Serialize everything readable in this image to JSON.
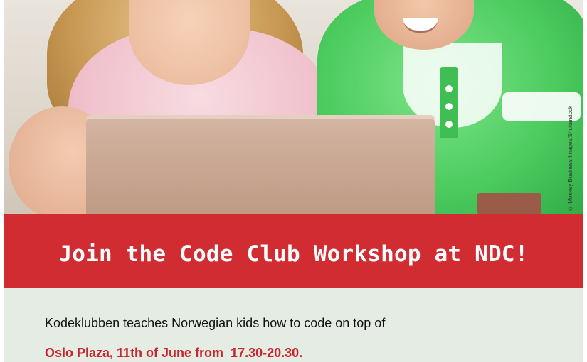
{
  "photo": {
    "credit": "© Monkey Business Images/Shutterstock"
  },
  "banner": {
    "title": "Join the Code Club Workshop at NDC!"
  },
  "body": {
    "intro": "Kodeklubben teaches Norwegian kids how to code on top of",
    "event": "Oslo Plaza, 11th of June from  17.30-20.30."
  },
  "colors": {
    "banner_red": "#d02c32",
    "body_bg": "#e4ece3",
    "event_red": "#c8262c",
    "shirt_green": "#4ccb5e",
    "shirt_pink": "#f0c2cd"
  }
}
